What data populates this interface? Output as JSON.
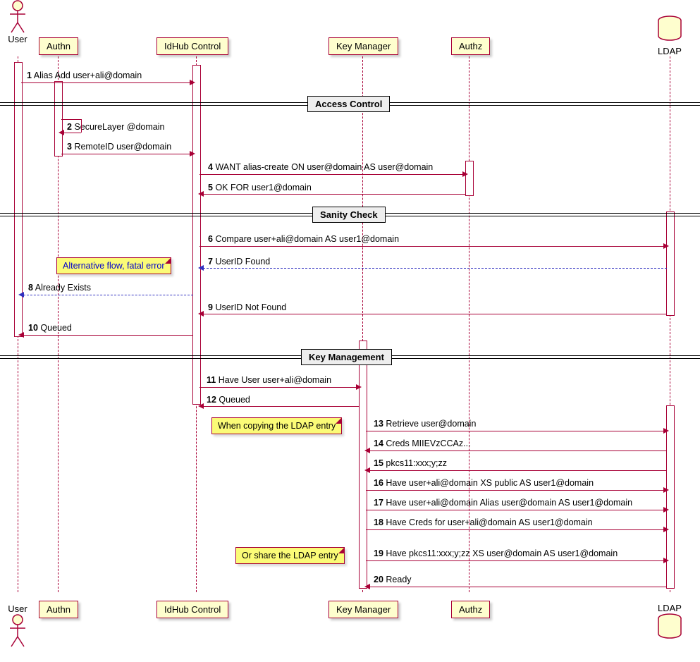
{
  "participants": {
    "user": "User",
    "authn": "Authn",
    "idhub": "IdHub Control",
    "keymgr": "Key Manager",
    "authz": "Authz",
    "ldap": "LDAP"
  },
  "dividers": {
    "access": "Access Control",
    "sanity": "Sanity Check",
    "keymgmt": "Key Management"
  },
  "notes": {
    "altflow": "Alternative flow, fatal error",
    "copy": "When copying the LDAP entry",
    "share": "Or share the LDAP entry"
  },
  "messages": {
    "m1": {
      "n": "1",
      "t": "Alias Add user+ali@domain"
    },
    "m2": {
      "n": "2",
      "t": "SecureLayer @domain"
    },
    "m3": {
      "n": "3",
      "t": "RemoteID user@domain"
    },
    "m4": {
      "n": "4",
      "t": "WANT alias-create ON user@domain AS user@domain"
    },
    "m5": {
      "n": "5",
      "t": "OK FOR user1@domain"
    },
    "m6": {
      "n": "6",
      "t": "Compare user+ali@domain AS user1@domain"
    },
    "m7": {
      "n": "7",
      "t": "UserID Found"
    },
    "m8": {
      "n": "8",
      "t": "Already Exists"
    },
    "m9": {
      "n": "9",
      "t": "UserID Not Found"
    },
    "m10": {
      "n": "10",
      "t": "Queued"
    },
    "m11": {
      "n": "11",
      "t": "Have User user+ali@domain"
    },
    "m12": {
      "n": "12",
      "t": "Queued"
    },
    "m13": {
      "n": "13",
      "t": "Retrieve user@domain"
    },
    "m14": {
      "n": "14",
      "t": "Creds MIIEVzCCAz..."
    },
    "m15": {
      "n": "15",
      "t": "pkcs11:xxx;y;zz"
    },
    "m16": {
      "n": "16",
      "t": "Have user+ali@domain XS public AS user1@domain"
    },
    "m17": {
      "n": "17",
      "t": "Have user+ali@domain Alias user@domain AS user1@domain"
    },
    "m18": {
      "n": "18",
      "t": "Have Creds for user+ali@domain AS user1@domain"
    },
    "m19": {
      "n": "19",
      "t": "Have pkcs11:xxx;y;zz XS user@domain AS user1@domain"
    },
    "m20": {
      "n": "20",
      "t": "Ready"
    }
  },
  "chart_data": {
    "type": "sequence-diagram",
    "participants": [
      "User",
      "Authn",
      "IdHub Control",
      "Key Manager",
      "Authz",
      "LDAP"
    ],
    "dividers": [
      "Access Control",
      "Sanity Check",
      "Key Management"
    ],
    "messages": [
      {
        "n": 1,
        "from": "User",
        "to": "IdHub Control",
        "text": "Alias Add user+ali@domain",
        "style": "solid"
      },
      {
        "divider": "Access Control"
      },
      {
        "n": 2,
        "from": "Authn",
        "to": "Authn",
        "text": "SecureLayer @domain",
        "style": "solid",
        "self": true
      },
      {
        "n": 3,
        "from": "Authn",
        "to": "IdHub Control",
        "text": "RemoteID user@domain",
        "style": "solid"
      },
      {
        "n": 4,
        "from": "IdHub Control",
        "to": "Authz",
        "text": "WANT alias-create ON user@domain AS user@domain",
        "style": "solid"
      },
      {
        "n": 5,
        "from": "Authz",
        "to": "IdHub Control",
        "text": "OK FOR user1@domain",
        "style": "solid"
      },
      {
        "divider": "Sanity Check"
      },
      {
        "n": 6,
        "from": "IdHub Control",
        "to": "LDAP",
        "text": "Compare user+ali@domain AS user1@domain",
        "style": "solid"
      },
      {
        "note": "Alternative flow, fatal error"
      },
      {
        "n": 7,
        "from": "LDAP",
        "to": "IdHub Control",
        "text": "UserID Found",
        "style": "dashed"
      },
      {
        "n": 8,
        "from": "IdHub Control",
        "to": "User",
        "text": "Already Exists",
        "style": "dashed"
      },
      {
        "n": 9,
        "from": "LDAP",
        "to": "IdHub Control",
        "text": "UserID Not Found",
        "style": "solid"
      },
      {
        "n": 10,
        "from": "IdHub Control",
        "to": "User",
        "text": "Queued",
        "style": "solid"
      },
      {
        "divider": "Key Management"
      },
      {
        "n": 11,
        "from": "IdHub Control",
        "to": "Key Manager",
        "text": "Have User user+ali@domain",
        "style": "solid"
      },
      {
        "n": 12,
        "from": "Key Manager",
        "to": "IdHub Control",
        "text": "Queued",
        "style": "solid"
      },
      {
        "note": "When copying the LDAP entry"
      },
      {
        "n": 13,
        "from": "Key Manager",
        "to": "LDAP",
        "text": "Retrieve user@domain",
        "style": "solid"
      },
      {
        "n": 14,
        "from": "LDAP",
        "to": "Key Manager",
        "text": "Creds MIIEVzCCAz...",
        "style": "solid"
      },
      {
        "n": 15,
        "from": "LDAP",
        "to": "Key Manager",
        "text": "pkcs11:xxx;y;zz",
        "style": "solid"
      },
      {
        "n": 16,
        "from": "Key Manager",
        "to": "LDAP",
        "text": "Have user+ali@domain XS public AS user1@domain",
        "style": "solid"
      },
      {
        "n": 17,
        "from": "Key Manager",
        "to": "LDAP",
        "text": "Have user+ali@domain Alias user@domain AS user1@domain",
        "style": "solid"
      },
      {
        "n": 18,
        "from": "Key Manager",
        "to": "LDAP",
        "text": "Have Creds for user+ali@domain AS user1@domain",
        "style": "solid"
      },
      {
        "note": "Or share the LDAP entry"
      },
      {
        "n": 19,
        "from": "Key Manager",
        "to": "LDAP",
        "text": "Have pkcs11:xxx;y;zz XS user@domain AS user1@domain",
        "style": "solid"
      },
      {
        "n": 20,
        "from": "LDAP",
        "to": "Key Manager",
        "text": "Ready",
        "style": "solid"
      }
    ]
  }
}
